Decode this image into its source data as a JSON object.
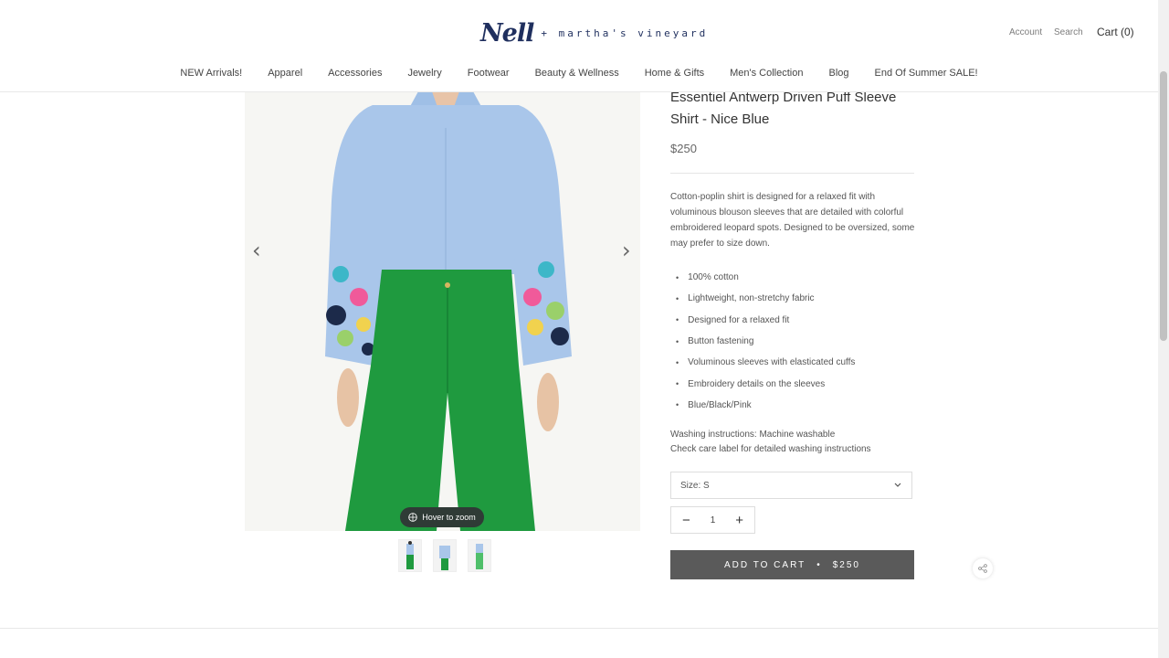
{
  "header": {
    "logo": {
      "script": "Nell",
      "rest": "+ martha's vineyard"
    },
    "account": "Account",
    "search": "Search",
    "cart": "Cart (0)"
  },
  "nav": [
    "NEW Arrivals!",
    "Apparel",
    "Accessories",
    "Jewelry",
    "Footwear",
    "Beauty & Wellness",
    "Home & Gifts",
    "Men's Collection",
    "Blog",
    "End Of Summer SALE!"
  ],
  "gallery": {
    "prev_icon": "chevron-left-icon",
    "next_icon": "chevron-right-icon",
    "zoom_label": "Hover to zoom",
    "thumbnail_count": 3
  },
  "product": {
    "title": "Essentiel Antwerp Driven Puff Sleeve Shirt - Nice Blue",
    "price": "$250",
    "description": "Cotton-poplin shirt is designed for a relaxed fit with voluminous blouson sleeves that are detailed with colorful embroidered leopard spots. Designed to be oversized, some may prefer to size down.",
    "features": [
      "100% cotton",
      "Lightweight, non-stretchy fabric",
      "Designed for a relaxed fit",
      "Button fastening",
      "Voluminous sleeves with elasticated cuffs",
      "Embroidery details on the sleeves",
      "Blue/Black/Pink"
    ],
    "washing_line1": "Washing instructions: Machine washable",
    "washing_line2": "Check care label for detailed washing instructions",
    "size_select": "Size: S",
    "quantity": "1",
    "qty_minus": "−",
    "qty_plus": "+",
    "add_to_cart": "ADD TO CART",
    "cart_separator": "•",
    "cart_price": "$250"
  },
  "colors": {
    "brand_navy": "#1f2f5e",
    "button_gray": "#5a5a5a",
    "shirt_blue": "#a9c6ea",
    "pants_green": "#1f9a3f"
  }
}
